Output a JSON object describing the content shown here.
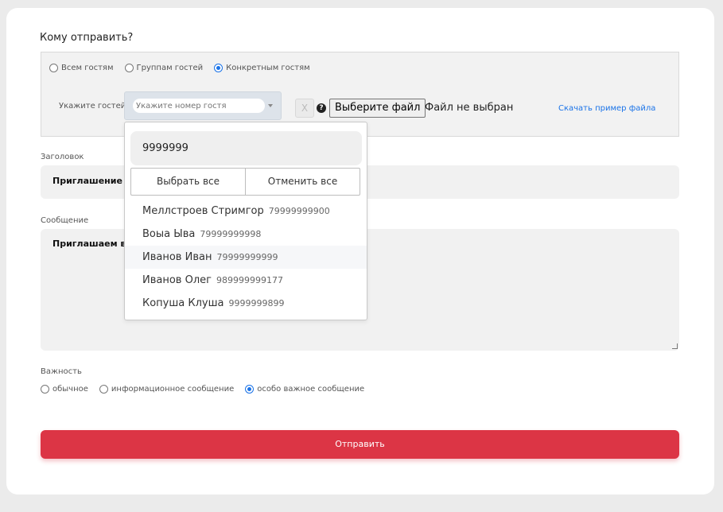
{
  "form": {
    "heading": "Кому отправить?",
    "recipient_options": [
      {
        "label": "Всем гостям",
        "selected": false
      },
      {
        "label": "Группам гостей",
        "selected": false
      },
      {
        "label": "Конкретным гостям",
        "selected": true
      }
    ],
    "guests_label": "Укажите гостей",
    "guest_input_placeholder": "Укажите номер гостя",
    "clear_button": "X",
    "file_button": "Выберите файл",
    "file_status": "Файл не выбран",
    "sample_link": "Скачать пример файла",
    "title_label": "Заголовок",
    "title_value": "Приглашение н",
    "message_label": "Сообщение",
    "message_value": "Приглашаем ва",
    "importance_label": "Важность",
    "importance_options": [
      {
        "label": "обычное",
        "selected": false
      },
      {
        "label": "информационное сообщение",
        "selected": false
      },
      {
        "label": "особо важное сообщение",
        "selected": true
      }
    ],
    "submit_label": "Отправить"
  },
  "dropdown": {
    "search_value": "9999999",
    "select_all": "Выбрать все",
    "deselect_all": "Отменить все",
    "items": [
      {
        "name": "Меллстроев Стримгор",
        "phone": "79999999900"
      },
      {
        "name": "Воыа Ыва",
        "phone": "79999999998"
      },
      {
        "name": "Иванов Иван",
        "phone": "79999999999"
      },
      {
        "name": "Иванов Олег",
        "phone": "989999999177"
      },
      {
        "name": "Копуша Клуша",
        "phone": "9999999899"
      }
    ],
    "highlighted_index": 2
  },
  "colors": {
    "accent": "#dc3545",
    "link": "#1a73e8"
  }
}
